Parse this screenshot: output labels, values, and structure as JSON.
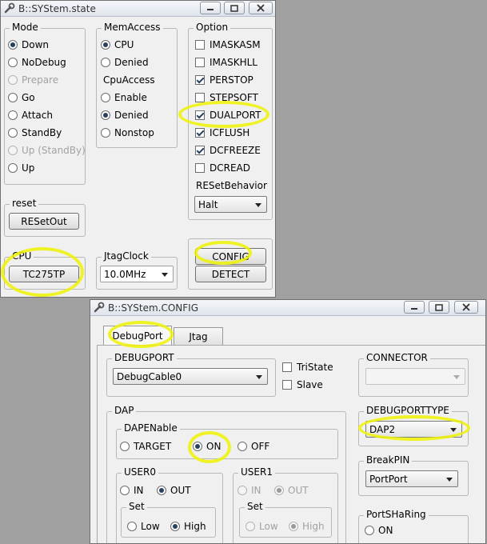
{
  "state_window": {
    "title": "B::SYStem.state",
    "mode": {
      "label": "Mode",
      "options": [
        {
          "label": "Down",
          "checked": true,
          "enabled": true
        },
        {
          "label": "NoDebug",
          "checked": false,
          "enabled": true
        },
        {
          "label": "Prepare",
          "checked": false,
          "enabled": false
        },
        {
          "label": "Go",
          "checked": false,
          "enabled": true
        },
        {
          "label": "Attach",
          "checked": false,
          "enabled": true
        },
        {
          "label": "StandBy",
          "checked": false,
          "enabled": true
        },
        {
          "label": "Up (StandBy)",
          "checked": false,
          "enabled": false
        },
        {
          "label": "Up",
          "checked": false,
          "enabled": true
        }
      ]
    },
    "memaccess": {
      "label": "MemAccess",
      "options": [
        {
          "label": "CPU",
          "checked": true
        },
        {
          "label": "Denied",
          "checked": false
        }
      ]
    },
    "cpuaccess": {
      "label": "CpuAccess",
      "options": [
        {
          "label": "Enable",
          "checked": false
        },
        {
          "label": "Denied",
          "checked": true
        },
        {
          "label": "Nonstop",
          "checked": false
        }
      ]
    },
    "option": {
      "label": "Option",
      "items": [
        {
          "label": "IMASKASM",
          "checked": false
        },
        {
          "label": "IMASKHLL",
          "checked": false
        },
        {
          "label": "PERSTOP",
          "checked": true
        },
        {
          "label": "STEPSOFT",
          "checked": false
        },
        {
          "label": "DUALPORT",
          "checked": true
        },
        {
          "label": "ICFLUSH",
          "checked": true
        },
        {
          "label": "DCFREEZE",
          "checked": true
        },
        {
          "label": "DCREAD",
          "checked": false
        }
      ]
    },
    "resetbehavior": {
      "label": "RESetBehavior",
      "value": "Halt"
    },
    "reset": {
      "label": "reset",
      "button": "RESetOut"
    },
    "cpu": {
      "label": "CPU",
      "button": "TC275TP"
    },
    "jtagclock": {
      "label": "JtagClock",
      "value": "10.0MHz"
    },
    "buttons": {
      "config": "CONFIG",
      "detect": "DETECT"
    }
  },
  "config_window": {
    "title": "B::SYStem.CONFIG",
    "tabs": [
      {
        "label": "DebugPort",
        "active": true
      },
      {
        "label": "Jtag",
        "active": false
      }
    ],
    "debugport": {
      "label": "DEBUGPORT",
      "value": "DebugCable0"
    },
    "tristate": {
      "label": "TriState",
      "checked": false
    },
    "slave": {
      "label": "Slave",
      "checked": false
    },
    "connector": {
      "label": "CONNECTOR",
      "value": ""
    },
    "dap": {
      "label": "DAP",
      "dapenable": {
        "label": "DAPENable",
        "options": [
          {
            "label": "TARGET",
            "checked": false
          },
          {
            "label": "ON",
            "checked": true
          },
          {
            "label": "OFF",
            "checked": false
          }
        ]
      },
      "user0": {
        "label": "USER0",
        "io": [
          {
            "label": "IN",
            "checked": false
          },
          {
            "label": "OUT",
            "checked": true
          }
        ],
        "set": {
          "label": "Set",
          "options": [
            {
              "label": "Low",
              "checked": false
            },
            {
              "label": "High",
              "checked": true
            }
          ]
        }
      },
      "user1": {
        "label": "USER1",
        "io": [
          {
            "label": "IN",
            "checked": false
          },
          {
            "label": "OUT",
            "checked": true
          }
        ],
        "set": {
          "label": "Set",
          "options": [
            {
              "label": "Low",
              "checked": false
            },
            {
              "label": "High",
              "checked": true
            }
          ]
        }
      }
    },
    "debugporttype": {
      "label": "DEBUGPORTTYPE",
      "value": "DAP2"
    },
    "breakpin": {
      "label": "BreakPIN",
      "value": "PortPort"
    },
    "portsharing": {
      "label": "PortSHaRing",
      "options": [
        {
          "label": "ON",
          "checked": false
        }
      ]
    }
  },
  "highlight_color": "#eef200"
}
